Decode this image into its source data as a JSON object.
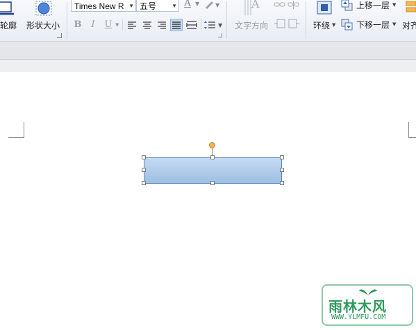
{
  "ribbon": {
    "outline_label": "轮廓",
    "shape_size_label": "形状大小",
    "font_name": "Times New R",
    "font_size": "五号",
    "text_direction_label": "文字方向",
    "wrap_label": "环绕",
    "bring_forward_label": "上移一层",
    "send_backward_label": "下移一层",
    "align_label": "对齐",
    "bold_glyph": "B",
    "italic_glyph": "I",
    "underline_glyph": "U",
    "font_color_glyph": "A",
    "text_dir_glyph": "A"
  },
  "watermark": {
    "brand": "雨林木风",
    "url": "WWW.YLMFU.COM"
  },
  "colors": {
    "shape_fill_top": "#c5daf2",
    "shape_fill_bottom": "#9dbfe3",
    "shape_border": "#5b86b8",
    "rotate_handle": "#f5b24e",
    "watermark_green": "#2e9a5c"
  }
}
